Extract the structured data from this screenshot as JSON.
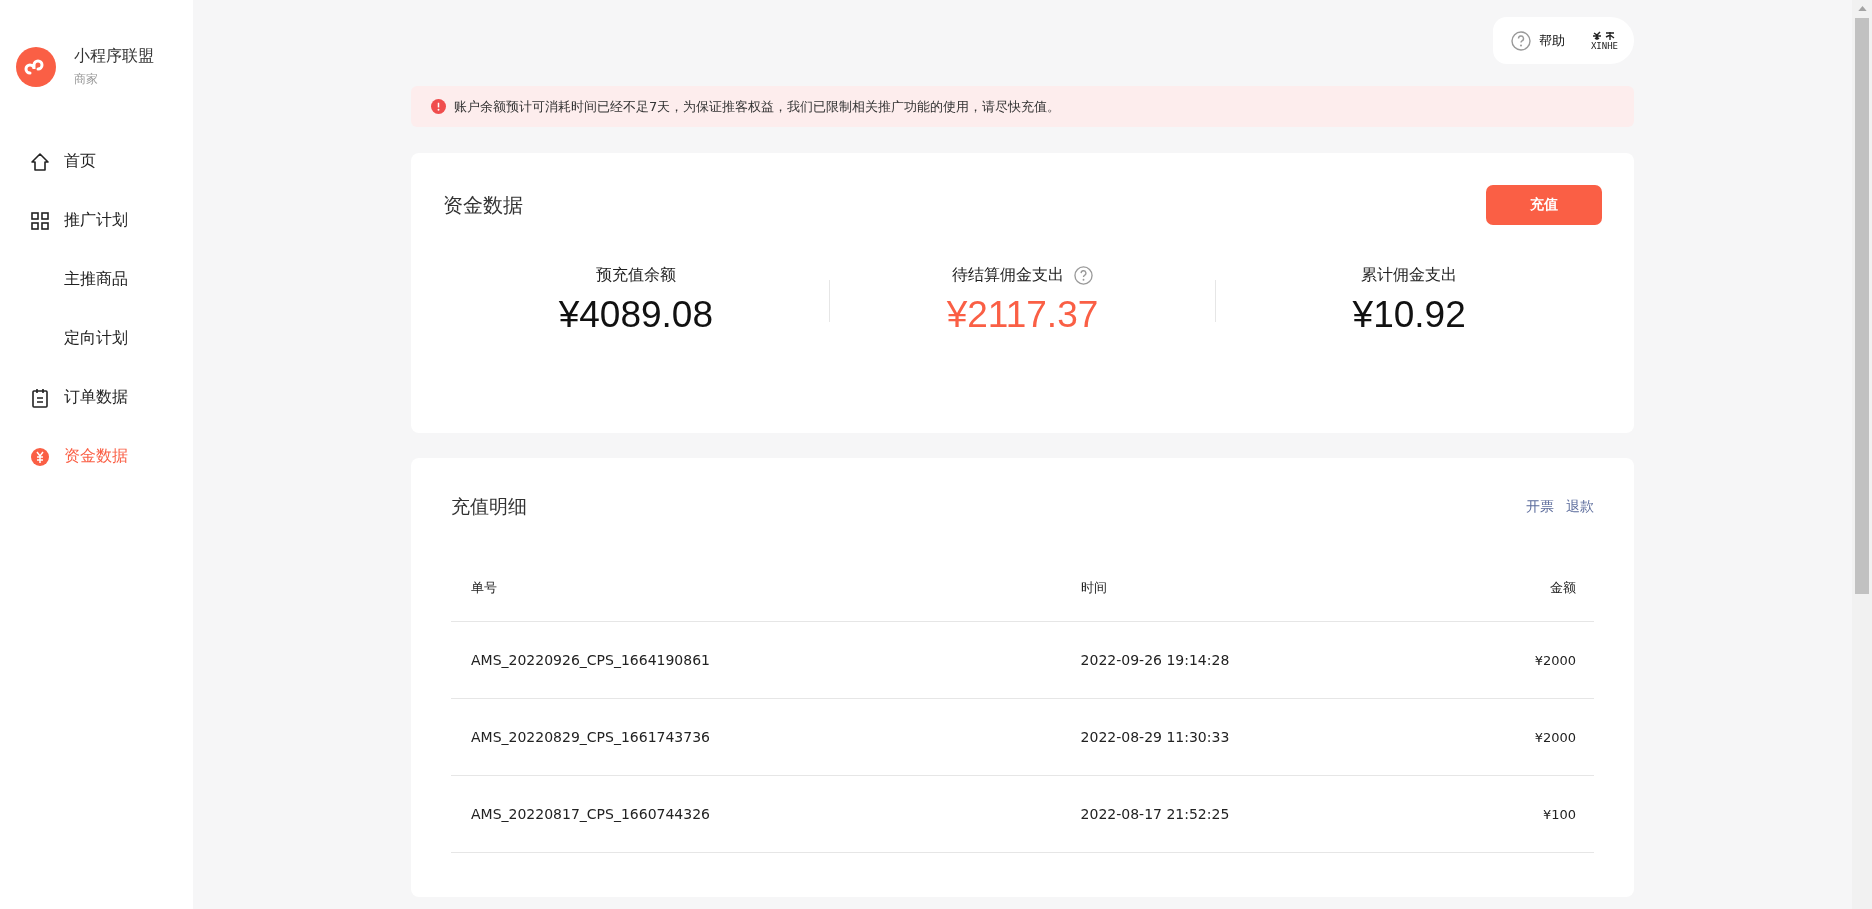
{
  "sidebar": {
    "brand": {
      "name": "小程序联盟",
      "subtitle": "商家"
    },
    "items": [
      {
        "kind": "main",
        "label": "首页",
        "selected": false
      },
      {
        "kind": "main",
        "label": "推广计划",
        "selected": false
      },
      {
        "kind": "sub",
        "label": "主推商品",
        "selected": false
      },
      {
        "kind": "sub",
        "label": "定向计划",
        "selected": false
      },
      {
        "kind": "main",
        "label": "订单数据",
        "selected": false
      },
      {
        "kind": "main",
        "label": "资金数据",
        "selected": true
      }
    ]
  },
  "topbar": {
    "help": "帮助",
    "account_logo": "XINHE"
  },
  "alert": {
    "message": "账户余额预计可消耗时间已经不足7天，为保证推客权益，我们已限制相关推广功能的使用，请尽快充值。"
  },
  "funds": {
    "title": "资金数据",
    "recharge_button": "充值",
    "stats": [
      {
        "kind": "plain",
        "label": "预充值余额",
        "value": "¥4089.08",
        "highlight": false
      },
      {
        "kind": "help",
        "label": "待结算佣金支出",
        "value": "¥2117.37",
        "highlight": true
      },
      {
        "kind": "plain",
        "label": "累计佣金支出",
        "value": "¥10.92",
        "highlight": false
      }
    ]
  },
  "recharge_detail": {
    "title": "充值明细",
    "links": [
      "开票",
      "退款"
    ],
    "table": {
      "columns": [
        "单号",
        "时间",
        "金额"
      ],
      "rows": [
        [
          "AMS_20220926_CPS_1664190861",
          "2022-09-26 19:14:28",
          "¥2000"
        ],
        [
          "AMS_20220829_CPS_1661743736",
          "2022-08-29 11:30:33",
          "¥2000"
        ],
        [
          "AMS_20220817_CPS_1660744326",
          "2022-08-17 21:52:25",
          "¥100"
        ]
      ]
    }
  }
}
